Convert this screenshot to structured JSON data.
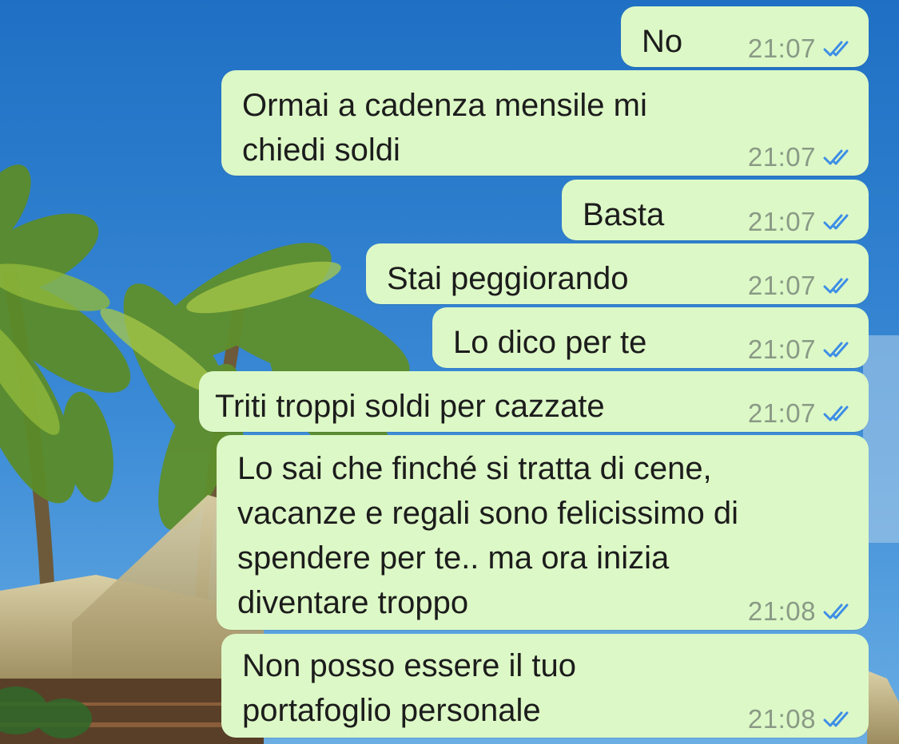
{
  "colors": {
    "bubble": "#dcf8c6",
    "text": "#1c1c1c",
    "time": "#8a9a86",
    "read_check": "#3d8ee6"
  },
  "background_icon": "tropical-beach-wallpaper",
  "messages": [
    {
      "text": "No",
      "time": "21:07",
      "status_icon": "double-check-read-icon"
    },
    {
      "text": "Ormai a cadenza mensile mi\nchiedi soldi",
      "time": "21:07",
      "status_icon": "double-check-read-icon"
    },
    {
      "text": "Basta",
      "time": "21:07",
      "status_icon": "double-check-read-icon"
    },
    {
      "text": "Stai peggiorando",
      "time": "21:07",
      "status_icon": "double-check-read-icon"
    },
    {
      "text": "Lo dico per te",
      "time": "21:07",
      "status_icon": "double-check-read-icon"
    },
    {
      "text": "Triti troppi soldi per cazzate",
      "time": "21:07",
      "status_icon": "double-check-read-icon"
    },
    {
      "text": "Lo sai che finché si tratta di cene,\nvacanze e regali sono felicissimo di\nspendere per te.. ma ora inizia\ndiventare troppo",
      "time": "21:08",
      "status_icon": "double-check-read-icon"
    },
    {
      "text": "Non posso essere il tuo\nportafoglio personale",
      "time": "21:08",
      "status_icon": "double-check-read-icon"
    }
  ]
}
